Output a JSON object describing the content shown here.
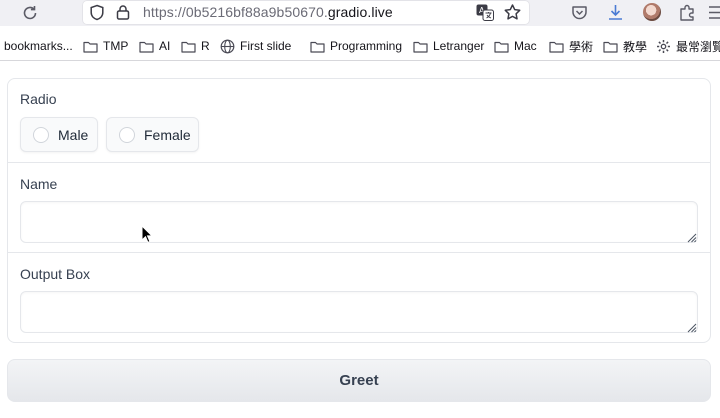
{
  "browser": {
    "url_prefix": "https://0b5216bf88a9b50670.",
    "url_host": "gradio.live",
    "icons": [
      "reload-icon",
      "shield-icon",
      "lock-icon",
      "translate-icon",
      "star-icon",
      "pocket-icon",
      "download-icon",
      "extensions-icon",
      "more-icon"
    ]
  },
  "bookmarks": [
    {
      "label": "bookmarks...",
      "icon": "none"
    },
    {
      "label": "TMP",
      "icon": "folder-icon"
    },
    {
      "label": "AI",
      "icon": "folder-icon"
    },
    {
      "label": "R",
      "icon": "folder-icon"
    },
    {
      "label": "First slide",
      "icon": "globe-icon"
    },
    {
      "label": "Programming",
      "icon": "folder-icon"
    },
    {
      "label": "Letranger",
      "icon": "folder-icon"
    },
    {
      "label": "Mac",
      "icon": "folder-icon"
    },
    {
      "label": "學術",
      "icon": "folder-icon"
    },
    {
      "label": "教學",
      "icon": "folder-icon"
    },
    {
      "label": "最常瀏覽",
      "icon": "gear-icon"
    }
  ],
  "app": {
    "radio": {
      "label": "Radio",
      "options": [
        "Male",
        "Female"
      ],
      "selected": null
    },
    "name": {
      "label": "Name",
      "value": "",
      "placeholder": ""
    },
    "output": {
      "label": "Output Box",
      "value": ""
    },
    "greet_button": "Greet"
  }
}
